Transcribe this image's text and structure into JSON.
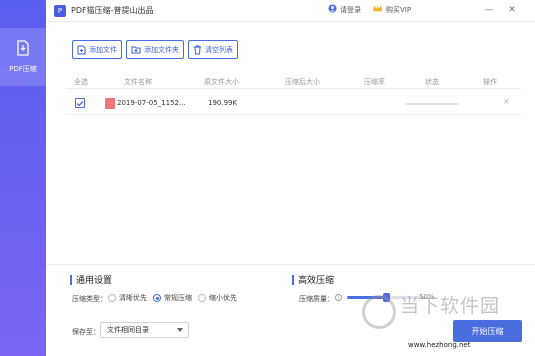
{
  "app": {
    "title": "PDF猫压缩-普提山出品",
    "login": "请登录",
    "vip": "购买VIP"
  },
  "sidebar": {
    "items": [
      {
        "label": "PDF压缩"
      }
    ]
  },
  "toolbar": {
    "add_file": "添加文件",
    "add_folder": "添加文件夹",
    "clear_list": "清空列表"
  },
  "table": {
    "headers": [
      "全选",
      "文件名称",
      "原文件大小",
      "压缩后大小",
      "压缩率",
      "状态",
      "操作"
    ],
    "rows": [
      {
        "checked": true,
        "name": "2019-07-05_1152...",
        "original_size": "190.99K",
        "compressed_size": "",
        "ratio": "",
        "status": "",
        "progress": 0
      }
    ]
  },
  "settings": {
    "general_title": "通用设置",
    "compress_type_label": "压缩类型：",
    "options": [
      "清晰优先",
      "常规压缩",
      "缩小优先"
    ],
    "selected_option": "常规压缩",
    "save_to_label": "保存至：",
    "save_to_value": "文件相同目录",
    "advanced_title": "高效压缩",
    "quality_label": "压缩质量：",
    "quality_value": 0.5,
    "quality_text": "50%",
    "start_button": "开始压缩"
  },
  "watermark": {
    "text": "当下软件园",
    "url": "www.hezhong.net"
  },
  "colors": {
    "accent": "#4a6ee0",
    "sidebar_top": "#5a5ef0",
    "sidebar_bottom": "#7a66f3"
  }
}
